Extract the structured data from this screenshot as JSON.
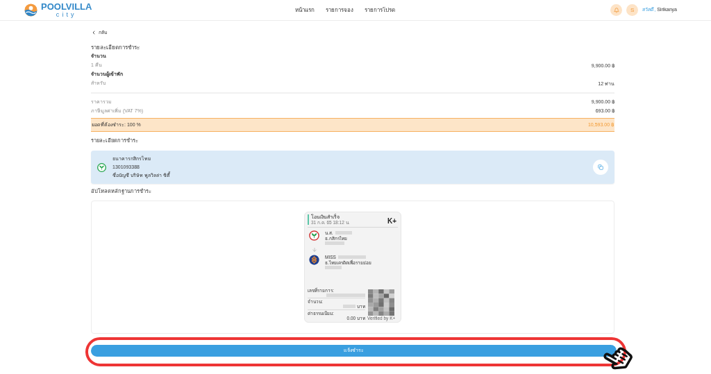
{
  "header": {
    "logo": {
      "name": "POOLVILLA",
      "sub": "city"
    },
    "nav": [
      {
        "label": "หน้าแรก"
      },
      {
        "label": "รายการจอง"
      },
      {
        "label": "รายการโปรด"
      }
    ],
    "avatar_initial": "S",
    "greeting": "สวัสดี,",
    "user_name": "Sirikanya"
  },
  "back_link": "กลับ",
  "summary": {
    "title": "รายละเอียดการชำระ",
    "items": [
      {
        "label": "จำนวน",
        "detail": "1 คืน",
        "value": "9,900.00 ฿"
      },
      {
        "label": "จำนวนผู้เข้าพัก",
        "detail": "สำหรับ",
        "value": "12 ท่าน"
      }
    ],
    "totals": [
      {
        "label": "ราคารวม",
        "value": "9,900.00 ฿"
      },
      {
        "label": "ภาษีมูลค่าเพิ่ม (VAT 7%)",
        "value": "693.00 ฿"
      }
    ],
    "due": {
      "label": "ยอดที่ต้องชำระ: 100 %",
      "value": "10,593.00 ฿"
    }
  },
  "bank": {
    "title": "รายละเอียดการชำระ",
    "name": "ธนาคารกสิกรไทย",
    "account_number": "1301093388",
    "account_name": "ชื่อบัญชี บริษัท พูลวิลล่า ซิตี้"
  },
  "upload": {
    "title": "อัปโหลดหลักฐานการชำระ",
    "slip": {
      "status": "โอนเงินสำเร็จ",
      "datetime": "31 ก.ค. 65 18:12 น.",
      "brand": "K+",
      "sender": {
        "title": "น.ส.",
        "bank": "ธ.กสิกรไทย"
      },
      "receiver": {
        "title": "MISS",
        "bank": "ธ.ไทยเครดิตเพื่อรายย่อย"
      },
      "reference_label": "เลขที่รายการ:",
      "amount_label": "จำนวน:",
      "amount_unit": "บาท",
      "fee_label": "ค่าธรรมเนียม:",
      "fee_value": "0.00 บาท",
      "verified": "Verified by K+"
    }
  },
  "submit_button": "แจ้งชำระ"
}
